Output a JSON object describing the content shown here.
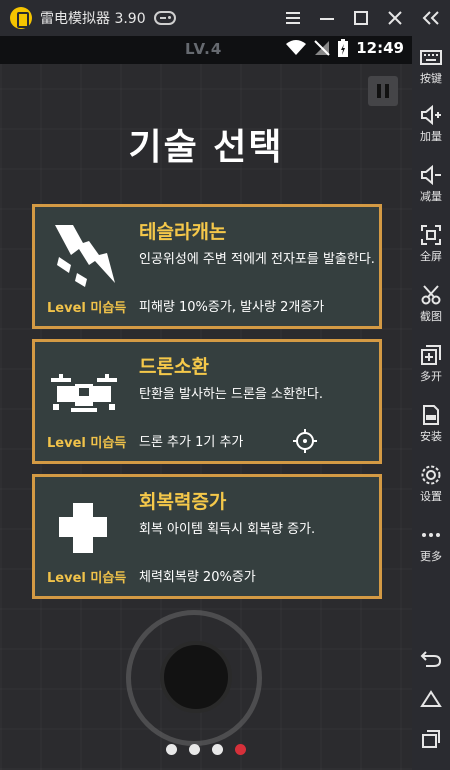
{
  "emulator": {
    "title": "雷电模拟器 3.90",
    "window_controls": [
      "menu",
      "minimize",
      "maximize",
      "close"
    ],
    "sidebar": [
      {
        "label": "按键",
        "icon": "keyboard-icon"
      },
      {
        "label": "加量",
        "icon": "volume-up-icon"
      },
      {
        "label": "减量",
        "icon": "volume-down-icon"
      },
      {
        "label": "全屏",
        "icon": "fullscreen-icon"
      },
      {
        "label": "截图",
        "icon": "scissors-icon"
      },
      {
        "label": "多开",
        "icon": "multi-instance-icon"
      },
      {
        "label": "安装",
        "icon": "apk-install-icon"
      },
      {
        "label": "设置",
        "icon": "gear-icon"
      },
      {
        "label": "更多",
        "icon": "more-icon"
      }
    ],
    "nav_buttons": [
      "back-icon",
      "home-icon",
      "recent-apps-icon"
    ]
  },
  "status": {
    "level": "LV.4",
    "time": "12:49"
  },
  "game": {
    "heading": "기술 선택",
    "cards": [
      {
        "title": "테슬라캐논",
        "description": "인공위성에 주변 적에게 전자포를 발출한다.",
        "level": "Level 미습득",
        "stat": "피해량 10%증가, 발사량 2개증가",
        "icon": "lightning-icon"
      },
      {
        "title": "드론소환",
        "description": "탄환을 발사하는 드론을 소환한다.",
        "level": "Level 미습득",
        "stat": "드론 추가 1기 추가",
        "icon": "drone-icon"
      },
      {
        "title": "회복력증가",
        "description": "회복 아이템 획득시 회복량 증가.",
        "level": "Level 미습득",
        "stat": "체력회복량 20%증가",
        "icon": "health-cross-icon"
      }
    ],
    "page_dots": {
      "count": 4,
      "active_index": 3
    },
    "colors": {
      "card_bg": "#353f3f",
      "card_border": "#d49a44",
      "title": "#f5c84a",
      "level": "#f0c24a",
      "active_dot": "#d6303a"
    }
  }
}
